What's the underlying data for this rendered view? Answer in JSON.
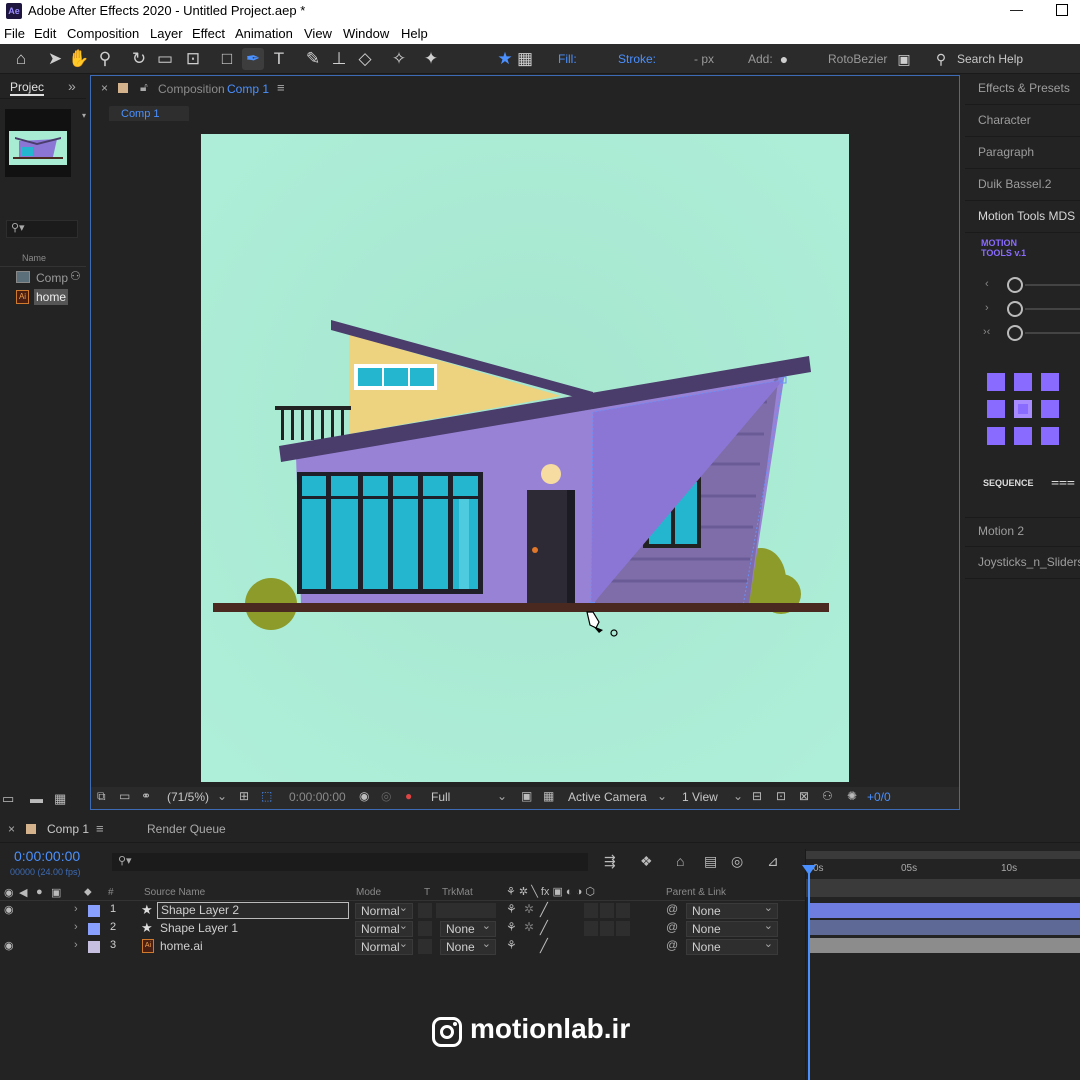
{
  "window": {
    "title": "Adobe After Effects 2020 - Untitled Project.aep *",
    "app_icon": "Ae"
  },
  "menu": [
    "File",
    "Edit",
    "Composition",
    "Layer",
    "Effect",
    "Animation",
    "View",
    "Window",
    "Help"
  ],
  "toolbar": {
    "fill_label": "Fill:",
    "fill_color": "#8b76d6",
    "stroke_label": "Stroke:",
    "stroke_unit": "- px",
    "add_label": "Add:",
    "rotobezier_label": "RotoBezier",
    "search_placeholder": "Search Help"
  },
  "project": {
    "tab": "Projec",
    "expand": "»",
    "name_header": "Name",
    "items": [
      {
        "label": "Comp",
        "icon": "composition-icon"
      },
      {
        "label": "home",
        "icon": "ai-file-icon"
      }
    ]
  },
  "composition": {
    "close": "×",
    "tab_prefix": "Composition",
    "tab_name": "Comp 1",
    "menu": "≡",
    "breadcrumb": "Comp 1"
  },
  "viewer_footer": {
    "zoom": "(71/5%)",
    "timecode": "0:00:00:00",
    "resolution": "Full",
    "camera": "Active Camera",
    "views": "1 View",
    "exposure": "+0/0"
  },
  "right_panels": [
    "Effects & Presets",
    "Character",
    "Paragraph",
    "Duik Bassel.2",
    "Motion Tools MDS",
    "Motion 2",
    "Joysticks_n_Sliders"
  ],
  "motion_tools": {
    "logo_line1": "MOTION",
    "logo_line2": "TOOLS v.1",
    "sequence_label": "SEQUENCE",
    "accent": "#8a6bff"
  },
  "timeline": {
    "close": "×",
    "comp_tab": "Comp 1",
    "render_queue": "Render Queue",
    "timecode": "0:00:00:00",
    "timecode_sub": "00000 (24.00 fps)",
    "headers": {
      "source_name": "Source Name",
      "mode": "Mode",
      "t": "T",
      "trkmat": "TrkMat",
      "parent": "Parent & Link"
    },
    "ruler": [
      "0s",
      "05s",
      "10s"
    ],
    "layers": [
      {
        "num": "1",
        "name": "Shape Layer 2",
        "mode": "Normal",
        "trkmat": "",
        "parent": "None",
        "color": "#8aa0ff",
        "bar_color": "#6f7de0"
      },
      {
        "num": "2",
        "name": "Shape Layer 1",
        "mode": "Normal",
        "trkmat": "None",
        "parent": "None",
        "color": "#8aa0ff",
        "bar_color": "#5f6996"
      },
      {
        "num": "3",
        "name": "home.ai",
        "mode": "Normal",
        "trkmat": "None",
        "parent": "None",
        "color": "#c7bfe0",
        "bar_color": "#8c8c8c"
      }
    ]
  },
  "watermark": "motionlab.ir"
}
